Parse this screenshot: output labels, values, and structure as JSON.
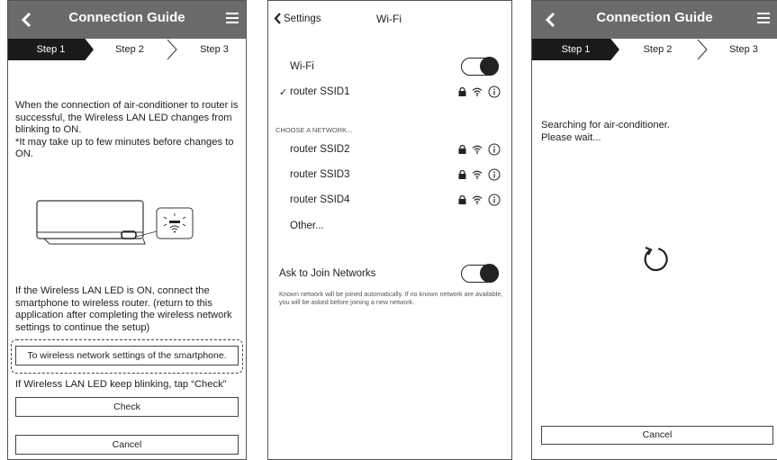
{
  "screen1": {
    "title": "Connection Guide",
    "steps": [
      "Step 1",
      "Step 2",
      "Step 3"
    ],
    "para1": "When the connection of air-conditioner to router is successful, the Wireless LAN LED changes from blinking to ON.",
    "para1_note": "*It may take up to few minutes before changes to ON.",
    "para2": "If the Wireless LAN LED is ON, connect the smartphone to wireless router. (return to this application after completing the wireless network settings to continue the setup)",
    "wifi_settings_button": "To wireless network settings of the smartphone.",
    "para3": "If Wireless LAN LED keep blinking, tap “Check”",
    "check_button": "Check",
    "cancel_button": "Cancel"
  },
  "screen2": {
    "back_label": "Settings",
    "title": "Wi-Fi",
    "wifi_label": "Wi-Fi",
    "connected_network": "router SSID1",
    "choose_header": "CHOOSE A NETWORK...",
    "networks": [
      "router SSID2",
      "router SSID3",
      "router SSID4"
    ],
    "other_label": "Other...",
    "ask_label": "Ask to Join Networks",
    "ask_note": "Known network will be joined automatically. If no known network are available, you will be asked before joining a new network."
  },
  "screen3": {
    "title": "Connection Guide",
    "steps": [
      "Step 1",
      "Step 2",
      "Step 3"
    ],
    "message_line1": "Searching for air-conditioner.",
    "message_line2": "Please wait...",
    "cancel_button": "Cancel"
  },
  "colors": {
    "header": "#6b6b6b",
    "active_step": "#1a1a1a"
  }
}
